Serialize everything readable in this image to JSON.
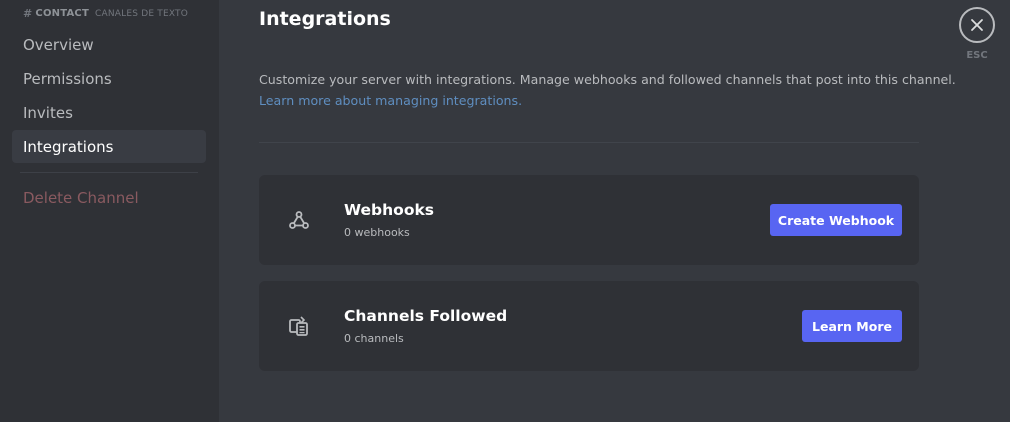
{
  "sidebar": {
    "channel_name": "CONTACT",
    "category_name": "CANALES DE TEXTO",
    "items": [
      {
        "label": "Overview"
      },
      {
        "label": "Permissions"
      },
      {
        "label": "Invites"
      },
      {
        "label": "Integrations"
      }
    ],
    "delete_label": "Delete Channel"
  },
  "main": {
    "title": "Integrations",
    "description": "Customize your server with integrations. Manage webhooks and followed channels that post into this channel.",
    "learn_link": "Learn more about managing integrations.",
    "cards": [
      {
        "title": "Webhooks",
        "subtitle": "0 webhooks",
        "button": "Create Webhook",
        "icon": "webhook-icon"
      },
      {
        "title": "Channels Followed",
        "subtitle": "0 channels",
        "button": "Learn More",
        "icon": "channels-followed-icon"
      }
    ]
  },
  "close": {
    "esc_label": "ESC"
  },
  "colors": {
    "accent": "#5865f2",
    "link": "#00aff4",
    "background": "#36393f",
    "sidebar": "#2f3136"
  }
}
